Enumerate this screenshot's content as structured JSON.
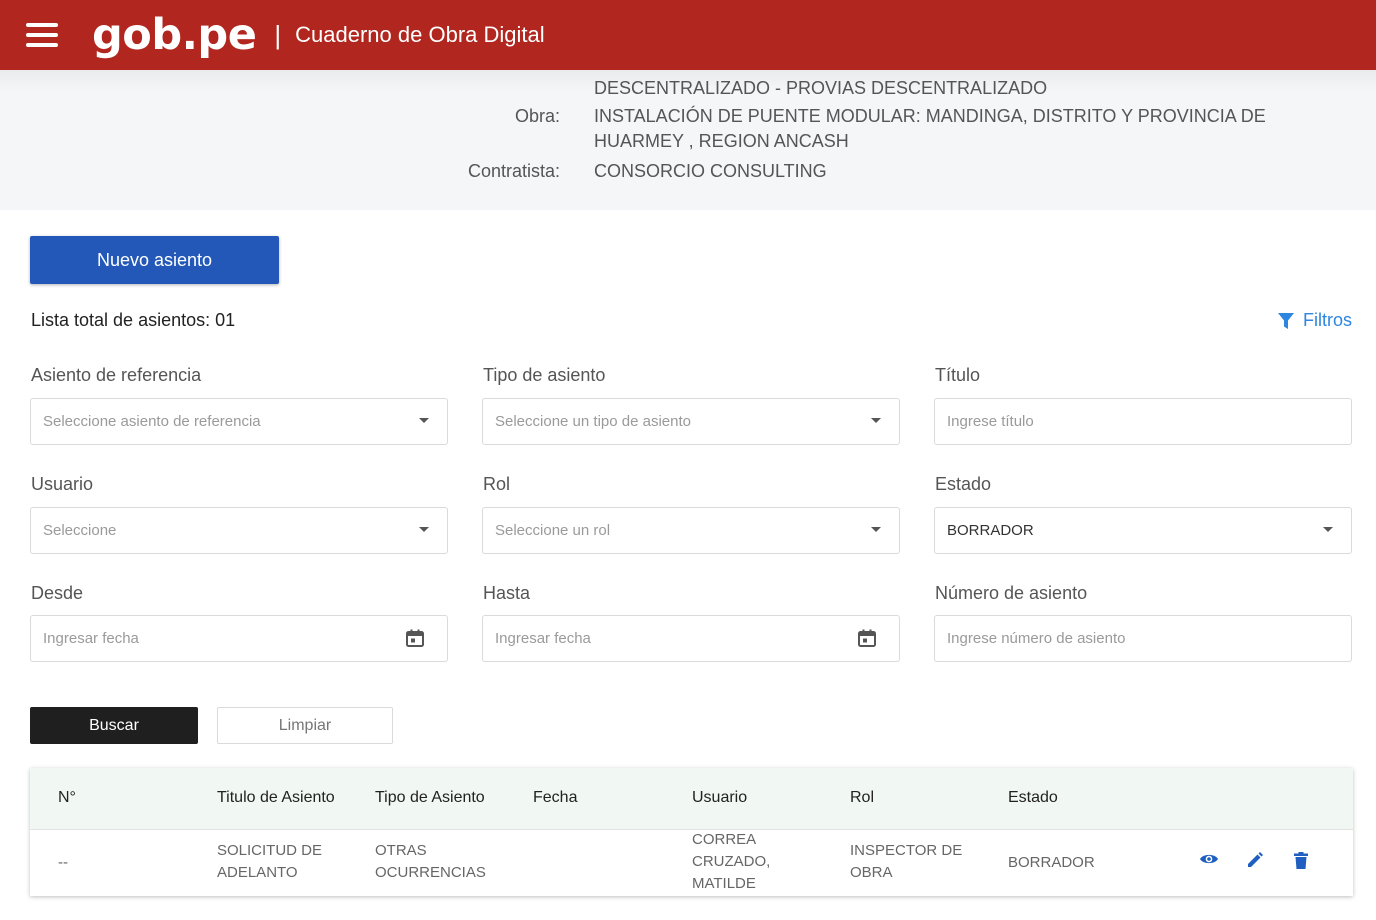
{
  "header": {
    "brand": "gob.pe",
    "separator": "|",
    "title": "Cuaderno de Obra Digital"
  },
  "obra_info": {
    "entity": "DESCENTRALIZADO - PROVIAS DESCENTRALIZADO",
    "obra_label": "Obra:",
    "obra_value_line1": "INSTALACIÓN DE PUENTE MODULAR: MANDINGA, DISTRITO Y PROVINCIA DE",
    "obra_value_line2": "HUARMEY , REGION ANCASH",
    "contratista_label": "Contratista:",
    "contratista_value": "CONSORCIO CONSULTING"
  },
  "actions": {
    "nuevo_asiento": "Nuevo asiento",
    "total_label": "Lista total de asientos: 01",
    "filtros": "Filtros"
  },
  "filters": {
    "asiento_ref_label": "Asiento de referencia",
    "asiento_ref_placeholder": "Seleccione asiento de referencia",
    "tipo_label": "Tipo de asiento",
    "tipo_placeholder": "Seleccione un tipo de asiento",
    "titulo_label": "Título",
    "titulo_placeholder": "Ingrese título",
    "usuario_label": "Usuario",
    "usuario_placeholder": "Seleccione",
    "rol_label": "Rol",
    "rol_placeholder": "Seleccione un rol",
    "estado_label": "Estado",
    "estado_value": "BORRADOR",
    "desde_label": "Desde",
    "desde_placeholder": "Ingresar fecha",
    "hasta_label": "Hasta",
    "hasta_placeholder": "Ingresar fecha",
    "numero_label": "Número de asiento",
    "numero_placeholder": "Ingrese número de asiento",
    "buscar": "Buscar",
    "limpiar": "Limpiar"
  },
  "table": {
    "columns": [
      "N°",
      "Titulo de Asiento",
      "Tipo de Asiento",
      "Fecha",
      "Usuario",
      "Rol",
      "Estado"
    ],
    "rows": [
      {
        "numero": "--",
        "titulo_line1": "SOLICITUD DE",
        "titulo_line2": "ADELANTO",
        "tipo_line1": "OTRAS",
        "tipo_line2": "OCURRENCIAS",
        "fecha": "",
        "usuario_line1": "CORREA",
        "usuario_line2": "CRUZADO,",
        "usuario_line3": "MATILDE",
        "rol_line1": "INSPECTOR DE",
        "rol_line2": "OBRA",
        "estado": "BORRADOR"
      }
    ]
  },
  "icons": {
    "hamburger": "menu-icon",
    "filter": "filter-icon",
    "calendar": "calendar-icon",
    "view": "eye-icon",
    "edit": "pencil-icon",
    "delete": "trash-icon"
  },
  "colors": {
    "header_bg": "#b1261e",
    "primary_button": "#2358b8",
    "link_blue": "#2e86e0",
    "dark_button": "#1f1f1f"
  }
}
